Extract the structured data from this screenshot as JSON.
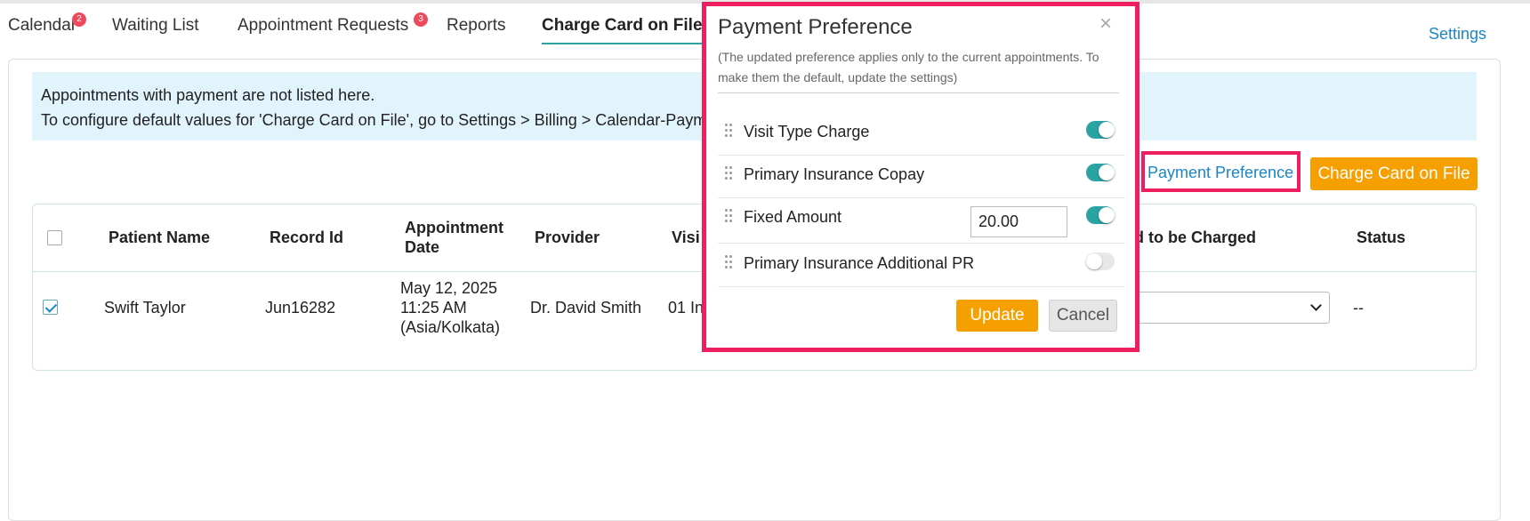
{
  "tabs": [
    {
      "label": "Calendar",
      "badge": "2"
    },
    {
      "label": "Waiting List"
    },
    {
      "label": "Appointment Requests",
      "badge": "3"
    },
    {
      "label": "Reports"
    },
    {
      "label": "Charge Card on File"
    }
  ],
  "settings_label": "Settings",
  "info": {
    "line1": "Appointments with payment are not listed here.",
    "line2": "To configure default values for 'Charge Card on File', go to Settings > Billing > Calendar-Paym"
  },
  "actions": {
    "payment_preference": "Payment Preference",
    "charge_card": "Charge Card on File"
  },
  "table": {
    "headers": {
      "patient_name": "Patient Name",
      "record_id": "Record Id",
      "appt_date_1": "Appointment",
      "appt_date_2": "Date",
      "provider": "Provider",
      "visit": "Visi",
      "amount_charged": "d to be Charged",
      "status": "Status"
    },
    "rows": [
      {
        "patient_name": "Swift Taylor",
        "record_id": "Jun16282",
        "date_line1": "May 12, 2025",
        "date_line2": "11:25 AM",
        "date_line3": "(Asia/Kolkata)",
        "provider": "Dr. David Smith",
        "visit": "01 In",
        "status": "--",
        "checked": true
      }
    ]
  },
  "modal": {
    "title": "Payment Preference",
    "close_glyph": "×",
    "note": "(The updated preference applies only to the current appointments. To make them the default, update the settings)",
    "items": [
      {
        "label": "Visit Type Charge",
        "enabled": true
      },
      {
        "label": "Primary Insurance Copay",
        "enabled": true
      },
      {
        "label": "Fixed Amount",
        "enabled": true,
        "amount": "20.00"
      },
      {
        "label": "Primary Insurance Additional PR",
        "enabled": false
      }
    ],
    "update_label": "Update",
    "cancel_label": "Cancel"
  },
  "colors": {
    "accent_teal": "#2aa3a3",
    "action_orange": "#f5a000",
    "highlight_pink": "#ee1e5f",
    "link_blue": "#1a86c7",
    "badge_red": "#ee4a5d",
    "info_bg": "#e1f3fb"
  }
}
